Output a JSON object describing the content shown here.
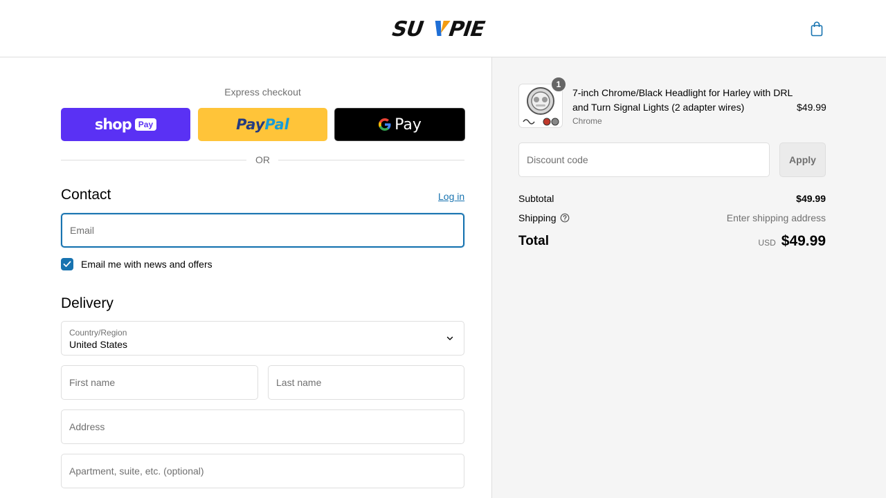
{
  "header": {
    "logo_text": "SUNPIE",
    "cart_icon": "shopping-bag-icon",
    "accent_color": "#1773b0"
  },
  "express": {
    "label": "Express checkout",
    "shop_pay": {
      "word": "shop",
      "badge": "Pay",
      "color": "#5a31f4"
    },
    "paypal": {
      "part1": "Pay",
      "part2": "Pal",
      "color": "#ffc439"
    },
    "gpay": {
      "text": "Pay",
      "color": "#000000"
    }
  },
  "divider": {
    "text": "OR"
  },
  "contact": {
    "title": "Contact",
    "login_link": "Log in",
    "email_placeholder": "Email",
    "newsletter_label": "Email me with news and offers",
    "newsletter_checked": true
  },
  "delivery": {
    "title": "Delivery",
    "country_label": "Country/Region",
    "country_value": "United States",
    "first_name_placeholder": "First name",
    "last_name_placeholder": "Last name",
    "address_placeholder": "Address",
    "apartment_placeholder": "Apartment, suite, etc. (optional)"
  },
  "summary": {
    "product": {
      "title": "7-inch Chrome/Black Headlight for Harley with DRL and Turn Signal Lights (2 adapter wires)",
      "variant": "Chrome",
      "price": "$49.99",
      "quantity": "1"
    },
    "discount_placeholder": "Discount code",
    "apply_label": "Apply",
    "subtotal_label": "Subtotal",
    "subtotal_value": "$49.99",
    "shipping_label": "Shipping",
    "shipping_value": "Enter shipping address",
    "total_label": "Total",
    "currency": "USD",
    "total_value": "$49.99"
  }
}
